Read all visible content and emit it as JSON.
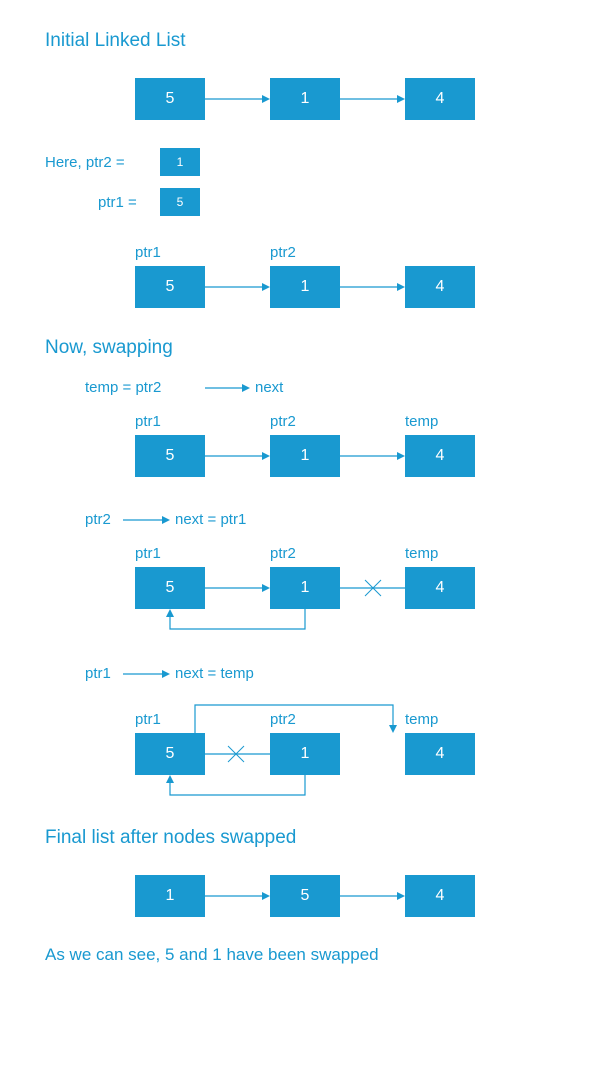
{
  "headings": {
    "initial": "Initial Linked List",
    "now_swap": "Now,   swapping",
    "final": "Final list after nodes swapped",
    "conclusion": "As we can see,  5 and 1 have been swapped"
  },
  "text": {
    "here_prefix": "Here,   ptr2  =",
    "ptr1_eq": "ptr1  =",
    "temp_eq_ptr2": "temp  =  ptr2",
    "next1": "next",
    "ptr2_label": "ptr2",
    "next_eq_ptr1": "next  =  ptr1",
    "ptr1_label": "ptr1",
    "next_eq_temp": "next  =  temp"
  },
  "labels": {
    "ptr1": "ptr1",
    "ptr2": "ptr2",
    "temp": "temp"
  },
  "nodes": {
    "n5": "5",
    "n1": "1",
    "n4": "4"
  },
  "small_nodes": {
    "s1": "1",
    "s5": "5"
  },
  "colors": {
    "primary": "#1999d0",
    "white": "#ffffff"
  }
}
